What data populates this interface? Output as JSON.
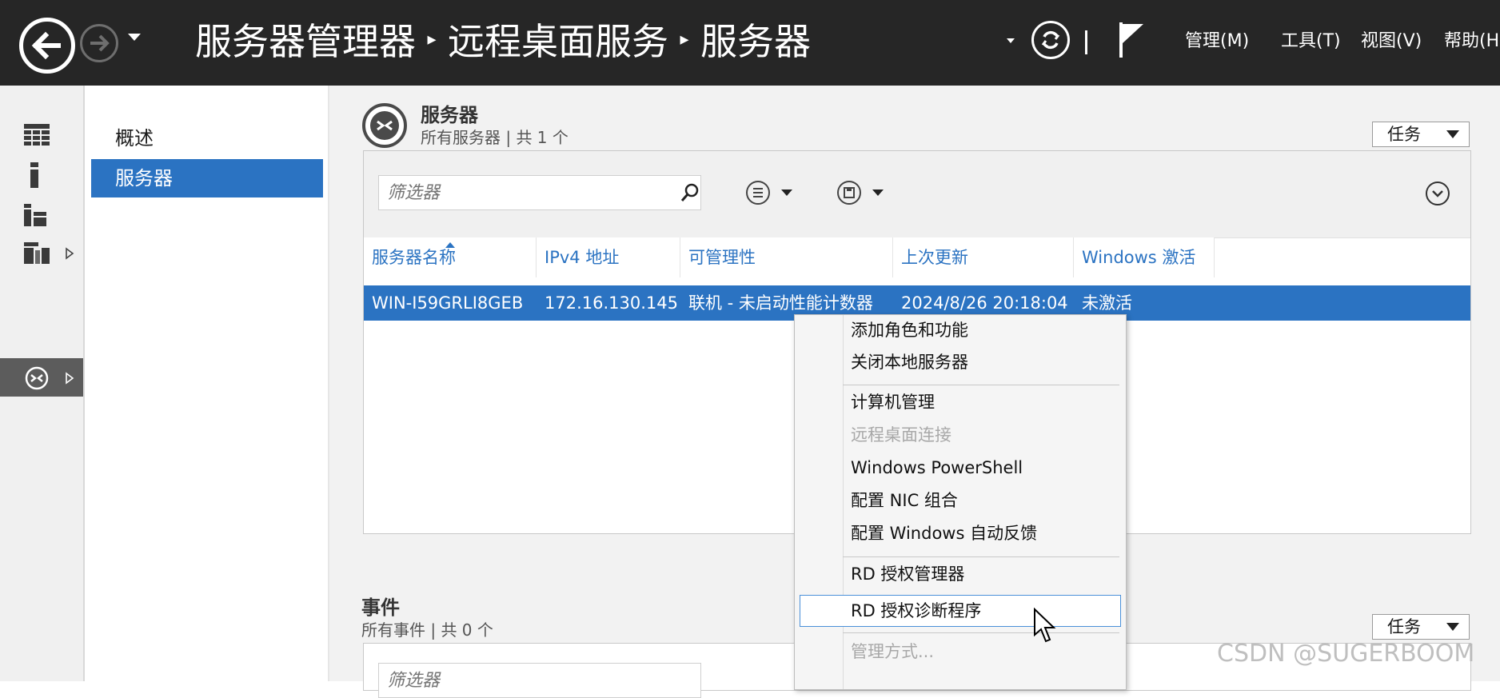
{
  "titlebar": {
    "breadcrumb": [
      "服务器管理器",
      "远程桌面服务",
      "服务器"
    ],
    "menu": [
      "管理(M)",
      "工具(T)",
      "视图(V)",
      "帮助(H"
    ]
  },
  "sidebar": {
    "icons": [
      "dashboard-icon",
      "local-server-icon",
      "all-servers-icon",
      "file-storage-icon",
      "remote-desktop-icon"
    ]
  },
  "subnav": {
    "items": [
      "概述",
      "服务器"
    ],
    "active": "服务器"
  },
  "servers_section": {
    "title": "服务器",
    "subtitle": "所有服务器 | 共 1 个",
    "tasks_label": "任务",
    "filter_placeholder": "筛选器",
    "columns": [
      "服务器名称",
      "IPv4 地址",
      "可管理性",
      "上次更新",
      "Windows 激活"
    ],
    "rows": [
      {
        "name": "WIN-I59GRLI8GEB",
        "ipv4": "172.16.130.145",
        "manageability": "联机 - 未启动性能计数器",
        "last_update": "2024/8/26 20:18:04",
        "activation": "未激活"
      }
    ]
  },
  "events_section": {
    "title": "事件",
    "subtitle": "所有事件 | 共 0 个",
    "tasks_label": "任务",
    "filter_placeholder": "筛选器"
  },
  "context_menu": {
    "items": [
      {
        "label": "添加角色和功能",
        "disabled": false
      },
      {
        "label": "关闭本地服务器",
        "disabled": false
      },
      {
        "label": "计算机管理",
        "disabled": false
      },
      {
        "label": "远程桌面连接",
        "disabled": true
      },
      {
        "label": "Windows PowerShell",
        "disabled": false
      },
      {
        "label": "配置 NIC 组合",
        "disabled": false
      },
      {
        "label": "配置 Windows 自动反馈",
        "disabled": false
      },
      {
        "label": "RD 授权管理器",
        "disabled": false
      },
      {
        "label": "RD 授权诊断程序",
        "disabled": false,
        "hovered": true
      },
      {
        "label": "管理方式...",
        "disabled": true
      }
    ]
  },
  "watermark": "CSDN @SUGERBOOM",
  "colors": {
    "titlebar": "#262626",
    "selection": "#2b73c2",
    "link": "#2b73c2"
  }
}
